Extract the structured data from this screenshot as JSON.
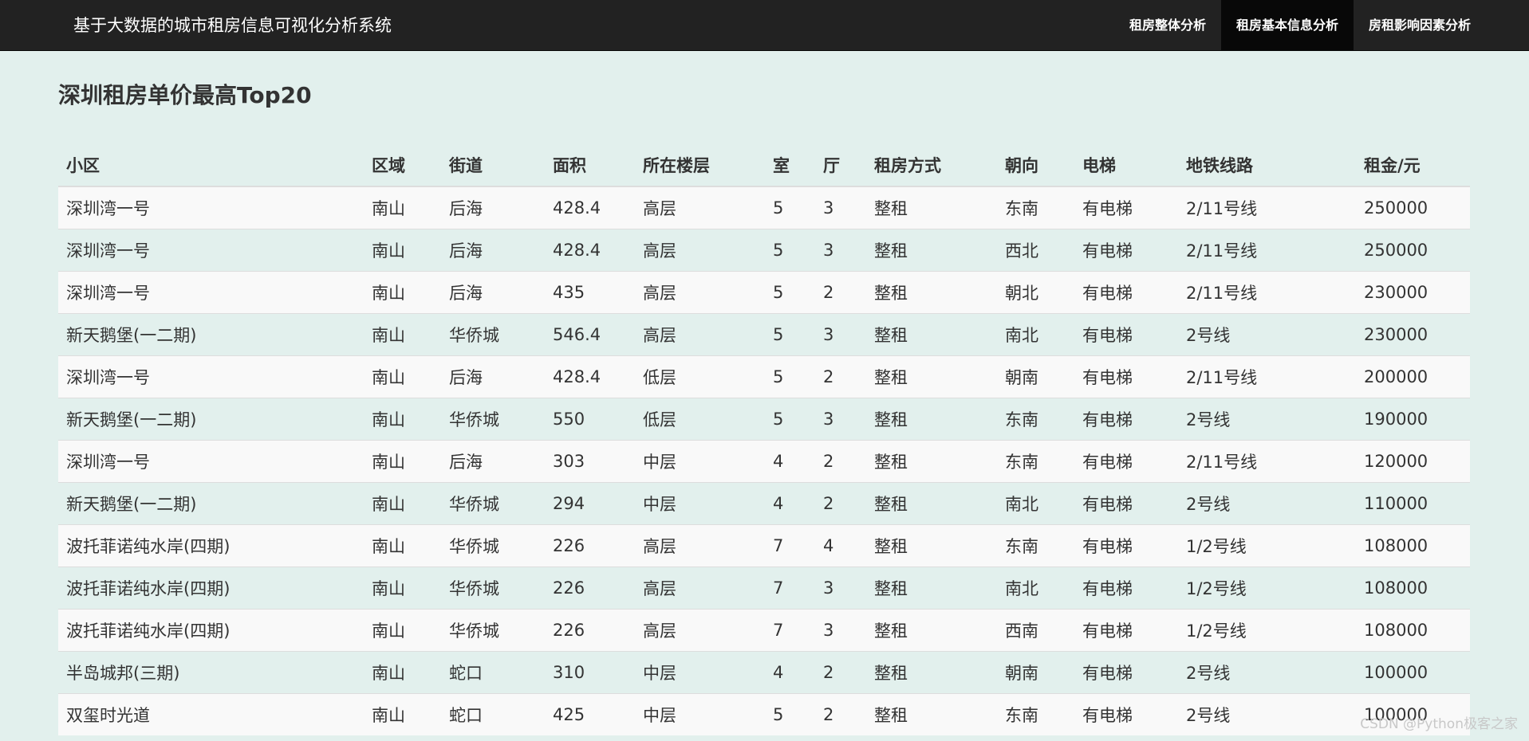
{
  "app": {
    "brand": "基于大数据的城市租房信息可视化分析系统"
  },
  "nav": {
    "items": [
      {
        "label": "租房整体分析"
      },
      {
        "label": "租房基本信息分析"
      },
      {
        "label": "房租影响因素分析"
      }
    ],
    "active_index": 1
  },
  "page": {
    "title": "深圳租房单价最高Top20"
  },
  "table": {
    "columns": [
      "小区",
      "区域",
      "街道",
      "面积",
      "所在楼层",
      "室",
      "厅",
      "租房方式",
      "朝向",
      "电梯",
      "地铁线路",
      "租金/元"
    ],
    "rows": [
      [
        "深圳湾一号",
        "南山",
        "后海",
        "428.4",
        "高层",
        "5",
        "3",
        "整租",
        "东南",
        "有电梯",
        "2/11号线",
        "250000"
      ],
      [
        "深圳湾一号",
        "南山",
        "后海",
        "428.4",
        "高层",
        "5",
        "3",
        "整租",
        "西北",
        "有电梯",
        "2/11号线",
        "250000"
      ],
      [
        "深圳湾一号",
        "南山",
        "后海",
        "435",
        "高层",
        "5",
        "2",
        "整租",
        "朝北",
        "有电梯",
        "2/11号线",
        "230000"
      ],
      [
        "新天鹅堡(一二期)",
        "南山",
        "华侨城",
        "546.4",
        "高层",
        "5",
        "3",
        "整租",
        "南北",
        "有电梯",
        "2号线",
        "230000"
      ],
      [
        "深圳湾一号",
        "南山",
        "后海",
        "428.4",
        "低层",
        "5",
        "2",
        "整租",
        "朝南",
        "有电梯",
        "2/11号线",
        "200000"
      ],
      [
        "新天鹅堡(一二期)",
        "南山",
        "华侨城",
        "550",
        "低层",
        "5",
        "3",
        "整租",
        "东南",
        "有电梯",
        "2号线",
        "190000"
      ],
      [
        "深圳湾一号",
        "南山",
        "后海",
        "303",
        "中层",
        "4",
        "2",
        "整租",
        "东南",
        "有电梯",
        "2/11号线",
        "120000"
      ],
      [
        "新天鹅堡(一二期)",
        "南山",
        "华侨城",
        "294",
        "中层",
        "4",
        "2",
        "整租",
        "南北",
        "有电梯",
        "2号线",
        "110000"
      ],
      [
        "波托菲诺纯水岸(四期)",
        "南山",
        "华侨城",
        "226",
        "高层",
        "7",
        "4",
        "整租",
        "东南",
        "有电梯",
        "1/2号线",
        "108000"
      ],
      [
        "波托菲诺纯水岸(四期)",
        "南山",
        "华侨城",
        "226",
        "高层",
        "7",
        "3",
        "整租",
        "南北",
        "有电梯",
        "1/2号线",
        "108000"
      ],
      [
        "波托菲诺纯水岸(四期)",
        "南山",
        "华侨城",
        "226",
        "高层",
        "7",
        "3",
        "整租",
        "西南",
        "有电梯",
        "1/2号线",
        "108000"
      ],
      [
        "半岛城邦(三期)",
        "南山",
        "蛇口",
        "310",
        "中层",
        "4",
        "2",
        "整租",
        "朝南",
        "有电梯",
        "2号线",
        "100000"
      ],
      [
        "双玺时光道",
        "南山",
        "蛇口",
        "425",
        "中层",
        "5",
        "2",
        "整租",
        "东南",
        "有电梯",
        "2号线",
        "100000"
      ]
    ]
  },
  "watermark": "CSDN @Python极客之家"
}
